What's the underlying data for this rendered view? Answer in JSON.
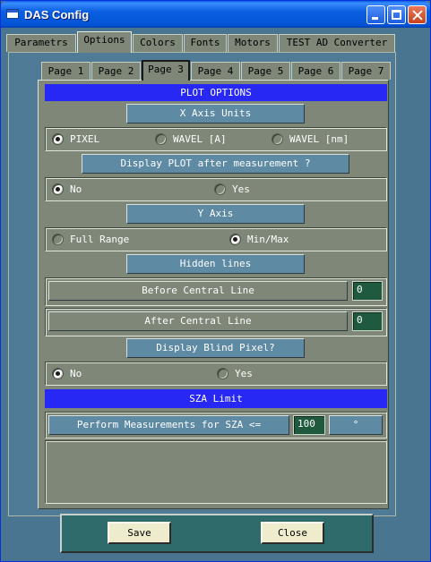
{
  "window": {
    "title": "DAS Config"
  },
  "outer_tabs": [
    "Parametrs",
    "Options",
    "Colors",
    "Fonts",
    "Motors",
    "TEST AD Converter"
  ],
  "inner_tabs": [
    "Page 1",
    "Page 2",
    "Page 3",
    "Page 4",
    "Page 5",
    "Page 6",
    "Page 7"
  ],
  "plot_options": {
    "banner": "PLOT OPTIONS",
    "x_axis_label": "X Axis Units",
    "x_axis_options": [
      "PIXEL",
      "WAVEL [A]",
      "WAVEL [nm]"
    ],
    "display_plot_label": "Display PLOT after measurement ?",
    "display_plot_options": [
      "No",
      "Yes"
    ],
    "y_axis_label": "Y Axis",
    "y_axis_options": [
      "Full Range",
      "Min/Max"
    ],
    "hidden_lines_label": "Hidden lines",
    "before_central_label": "Before Central Line",
    "before_central_value": "0",
    "after_central_label": "After Central Line",
    "after_central_value": "0",
    "blind_pixel_label": "Display Blind Pixel?",
    "blind_pixel_options": [
      "No",
      "Yes"
    ]
  },
  "sza": {
    "banner": "SZA Limit",
    "label": "Perform Measurements for SZA <=",
    "value": "100",
    "unit": "°"
  },
  "buttons": {
    "save": "Save",
    "close": "Close"
  }
}
